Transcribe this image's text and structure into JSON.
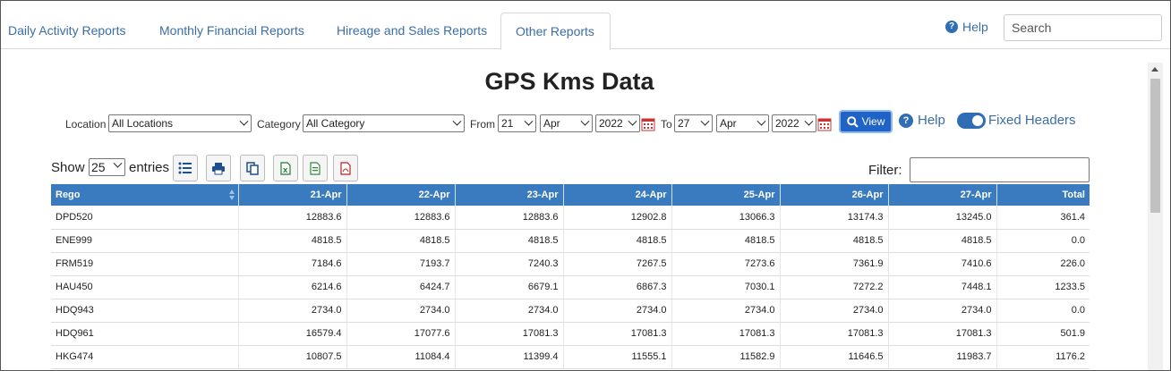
{
  "tabs": [
    {
      "label": "Daily Activity Reports"
    },
    {
      "label": "Monthly Financial Reports"
    },
    {
      "label": "Hireage and Sales Reports"
    },
    {
      "label": "Other Reports"
    }
  ],
  "header": {
    "help_label": "Help",
    "search_placeholder": "Search"
  },
  "page_title": "GPS Kms Data",
  "filters": {
    "location_label": "Location",
    "location_value": "All Locations",
    "category_label": "Category",
    "category_value": "All Category",
    "from_label": "From",
    "from_day": "21",
    "from_month": "Apr",
    "from_year": "2022",
    "to_label": "To",
    "to_day": "27",
    "to_month": "Apr",
    "to_year": "2022",
    "view_label": "View",
    "help_label": "Help",
    "fixed_headers_label": "Fixed Headers"
  },
  "table_controls": {
    "show_label": "Show",
    "entries_value": "25",
    "entries_label": "entries",
    "filter_label": "Filter:"
  },
  "table": {
    "headers": [
      "Rego",
      "21-Apr",
      "22-Apr",
      "23-Apr",
      "24-Apr",
      "25-Apr",
      "26-Apr",
      "27-Apr",
      "Total"
    ],
    "rows": [
      [
        "DPD520",
        "12883.6",
        "12883.6",
        "12883.6",
        "12902.8",
        "13066.3",
        "13174.3",
        "13245.0",
        "361.4"
      ],
      [
        "ENE999",
        "4818.5",
        "4818.5",
        "4818.5",
        "4818.5",
        "4818.5",
        "4818.5",
        "4818.5",
        "0.0"
      ],
      [
        "FRM519",
        "7184.6",
        "7193.7",
        "7240.3",
        "7267.5",
        "7273.6",
        "7361.9",
        "7410.6",
        "226.0"
      ],
      [
        "HAU450",
        "6214.6",
        "6424.7",
        "6679.1",
        "6867.3",
        "7030.1",
        "7272.2",
        "7448.1",
        "1233.5"
      ],
      [
        "HDQ943",
        "2734.0",
        "2734.0",
        "2734.0",
        "2734.0",
        "2734.0",
        "2734.0",
        "2734.0",
        "0.0"
      ],
      [
        "HDQ961",
        "16579.4",
        "17077.6",
        "17081.3",
        "17081.3",
        "17081.3",
        "17081.3",
        "17081.3",
        "501.9"
      ],
      [
        "HKG474",
        "10807.5",
        "11084.4",
        "11399.4",
        "11555.1",
        "11582.9",
        "11646.5",
        "11983.7",
        "1176.2"
      ]
    ]
  },
  "colors": {
    "accent": "#3a6ea5",
    "header_bg": "#3a7bbf",
    "view_btn": "#1f63c6"
  }
}
